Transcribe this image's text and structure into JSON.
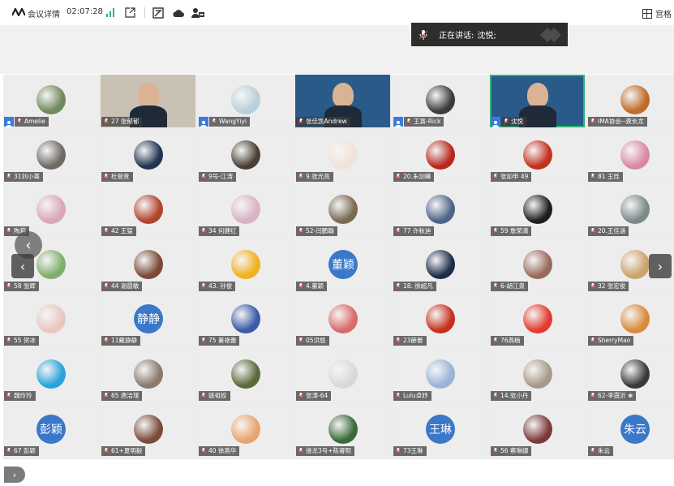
{
  "topbar": {
    "meeting_title": "会议详情",
    "timer": "02:07:28",
    "grid_view_label": "宫格"
  },
  "speaker_banner": {
    "label": "正在讲话:",
    "name": "沈悦;"
  },
  "tiles": [
    {
      "name": "Amelie",
      "host": true,
      "color": "#6f8a5c"
    },
    {
      "name": "27 张郁郁",
      "host": false,
      "color": "#c9c2b4",
      "video": true
    },
    {
      "name": "WangYiyi",
      "host": true,
      "color": "#b8d0d9"
    },
    {
      "name": "张佳凯Andrew",
      "host": false,
      "color": "#2a5a8a",
      "video": true
    },
    {
      "name": "王寅-Rick",
      "host": true,
      "color": "#3c3c3c"
    },
    {
      "name": "沈悦",
      "host": true,
      "color": "#2a5a8a",
      "video": true,
      "active": true
    },
    {
      "name": "IMA协会--龚长龙",
      "host": false,
      "color": "#c06b2a"
    },
    {
      "name": "31刘小菁",
      "host": false,
      "color": "#6e6a63"
    },
    {
      "name": "杜登贵",
      "host": false,
      "color": "#213552"
    },
    {
      "name": "9号-江涛",
      "host": false,
      "color": "#4a3f35"
    },
    {
      "name": "9.张光亮",
      "host": false,
      "color": "#f3e2d9"
    },
    {
      "name": "20.朱剑峰",
      "host": false,
      "color": "#b8271f"
    },
    {
      "name": "张如申 49",
      "host": false,
      "color": "#c4301e"
    },
    {
      "name": "81 王烁",
      "host": false,
      "color": "#d98aa2"
    },
    {
      "name": "陶莉",
      "host": false,
      "color": "#d9a7b6"
    },
    {
      "name": "42 王猛",
      "host": false,
      "color": "#b0442d"
    },
    {
      "name": "34 何健红",
      "host": false,
      "color": "#d9b2c4"
    },
    {
      "name": "52-闫鹏翰",
      "host": false,
      "color": "#7b6a52"
    },
    {
      "name": "77 许秋迪",
      "host": false,
      "color": "#4c6588"
    },
    {
      "name": "59 詹荣潇",
      "host": false,
      "color": "#1e1e1e"
    },
    {
      "name": "20.王佳涵",
      "host": false,
      "color": "#7c8a8a"
    },
    {
      "name": "58 张辉",
      "host": false,
      "color": "#7fae6a"
    },
    {
      "name": "44 谢晨敏",
      "host": false,
      "color": "#7a4a35"
    },
    {
      "name": "43. 孙俊",
      "host": false,
      "color": "#f0b21e"
    },
    {
      "name": "4.董颖",
      "host": false,
      "color": "#3a78c8",
      "text": "董颖"
    },
    {
      "name": "18. 徐超凡",
      "host": false,
      "color": "#1c2d4a"
    },
    {
      "name": "6-胡江泉",
      "host": false,
      "color": "#9a6b5a"
    },
    {
      "name": "32 张宏俊",
      "host": false,
      "color": "#c9a46b"
    },
    {
      "name": "55 贺冰",
      "host": false,
      "color": "#e9c7c0"
    },
    {
      "name": "11戴静静",
      "host": false,
      "color": "#3a78c8",
      "text": "静静"
    },
    {
      "name": "75 董艳蕾",
      "host": false,
      "color": "#3b5aa8"
    },
    {
      "name": "05洪悠",
      "host": false,
      "color": "#d96b6b"
    },
    {
      "name": "23薛蕾",
      "host": false,
      "color": "#c8301e"
    },
    {
      "name": "76燕楠",
      "host": false,
      "color": "#e23b2e"
    },
    {
      "name": "SherryMao",
      "host": false,
      "color": "#d98a3a"
    },
    {
      "name": "魏玲玲",
      "host": false,
      "color": "#2aa3d9"
    },
    {
      "name": "65 唐洁瑾",
      "host": false,
      "color": "#8a7a6a"
    },
    {
      "name": "姚祖姣",
      "host": false,
      "color": "#5a6a3a"
    },
    {
      "name": "张涛-64",
      "host": false,
      "color": "#d9d9d9"
    },
    {
      "name": "Lulu卓妤",
      "host": false,
      "color": "#9ab4d9"
    },
    {
      "name": "14.张小丹",
      "host": false,
      "color": "#a89a8a"
    },
    {
      "name": "62-李霞沂 ❀",
      "host": false,
      "color": "#3a3a3a"
    },
    {
      "name": "67 彭颖",
      "host": false,
      "color": "#3a78c8",
      "text": "彭颖"
    },
    {
      "name": "61+夏明毅",
      "host": false,
      "color": "#7a4a3a"
    },
    {
      "name": "40 徐燕华",
      "host": false,
      "color": "#e9a46b"
    },
    {
      "name": "接龙3号+陈睿熙",
      "host": false,
      "color": "#3a6a3a"
    },
    {
      "name": "73王琳",
      "host": false,
      "color": "#3a78c8",
      "text": "王琳"
    },
    {
      "name": "56 蔡琳娜",
      "host": false,
      "color": "#7a3a3a"
    },
    {
      "name": "朱云",
      "host": false,
      "color": "#3a78c8",
      "text": "朱云"
    }
  ],
  "nav": {
    "prev": "‹",
    "next": "›",
    "collapse": "›"
  }
}
